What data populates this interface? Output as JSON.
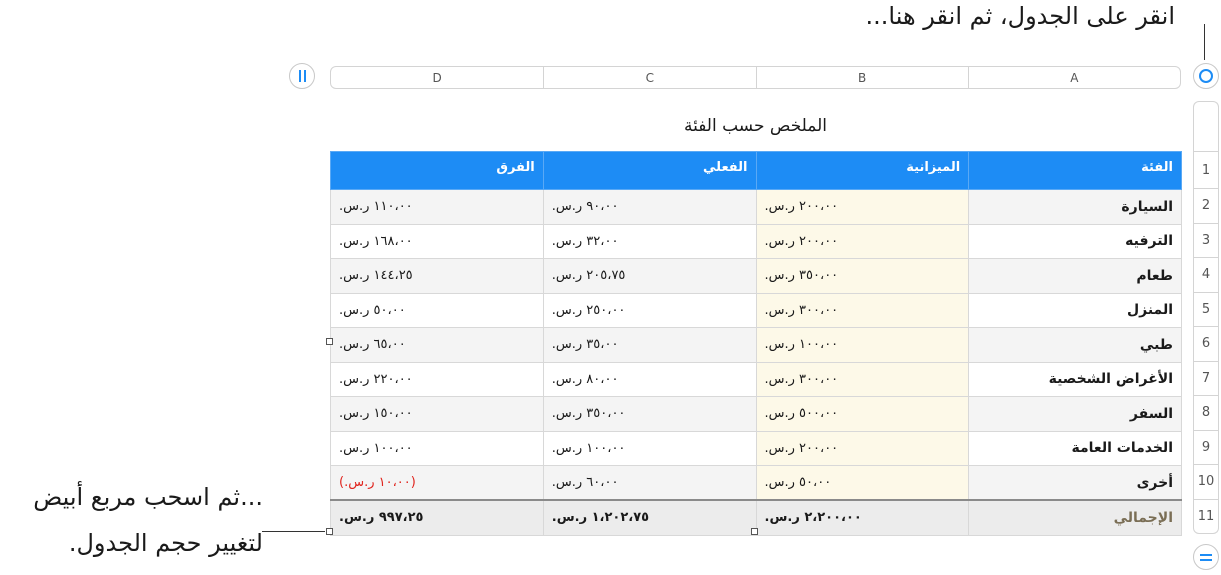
{
  "callouts": {
    "top": "انقر على الجدول، ثم انقر هنا...",
    "bottom_line1": "...ثم اسحب مربع أبيض",
    "bottom_line2": "لتغيير حجم الجدول."
  },
  "column_letters": [
    "A",
    "B",
    "C",
    "D"
  ],
  "row_numbers": [
    "1",
    "2",
    "3",
    "4",
    "5",
    "6",
    "7",
    "8",
    "9",
    "10",
    "11"
  ],
  "table": {
    "title": "الملخص حسب الفئة",
    "headers": [
      "الفئة",
      "الميزانية",
      "الفعلي",
      "الفرق"
    ],
    "rows": [
      [
        "السيارة",
        "٢٠٠،٠٠ ر.س.",
        "٩٠،٠٠ ر.س.",
        "١١٠،٠٠ ر.س."
      ],
      [
        "الترفيه",
        "٢٠٠،٠٠ ر.س.",
        "٣٢،٠٠ ر.س.",
        "١٦٨،٠٠ ر.س."
      ],
      [
        "طعام",
        "٣٥٠،٠٠ ر.س.",
        "٢٠٥،٧٥ ر.س.",
        "١٤٤،٢٥ ر.س."
      ],
      [
        "المنزل",
        "٣٠٠،٠٠ ر.س.",
        "٢٥٠،٠٠ ر.س.",
        "٥٠،٠٠ ر.س."
      ],
      [
        "طبي",
        "١٠٠،٠٠ ر.س.",
        "٣٥،٠٠ ر.س.",
        "٦٥،٠٠ ر.س."
      ],
      [
        "الأغراض الشخصية",
        "٣٠٠،٠٠ ر.س.",
        "٨٠،٠٠ ر.س.",
        "٢٢٠،٠٠ ر.س."
      ],
      [
        "السفر",
        "٥٠٠،٠٠ ر.س.",
        "٣٥٠،٠٠ ر.س.",
        "١٥٠،٠٠ ر.س."
      ],
      [
        "الخدمات العامة",
        "٢٠٠،٠٠ ر.س.",
        "١٠٠،٠٠ ر.س.",
        "١٠٠،٠٠ ر.س."
      ],
      [
        "أخرى",
        "٥٠،٠٠ ر.س.",
        "٦٠،٠٠ ر.س.",
        "(١٠،٠٠ ر.س.)"
      ]
    ],
    "total": [
      "الإجمالي",
      "٢،٢٠٠،٠٠ ر.س.",
      "١،٢٠٢،٧٥ ر.س.",
      "٩٩٧،٢٥ ر.س."
    ]
  },
  "colors": {
    "accent": "#1d8cf5",
    "negative": "#e0261f",
    "budget_column": "#fdf9e8"
  }
}
